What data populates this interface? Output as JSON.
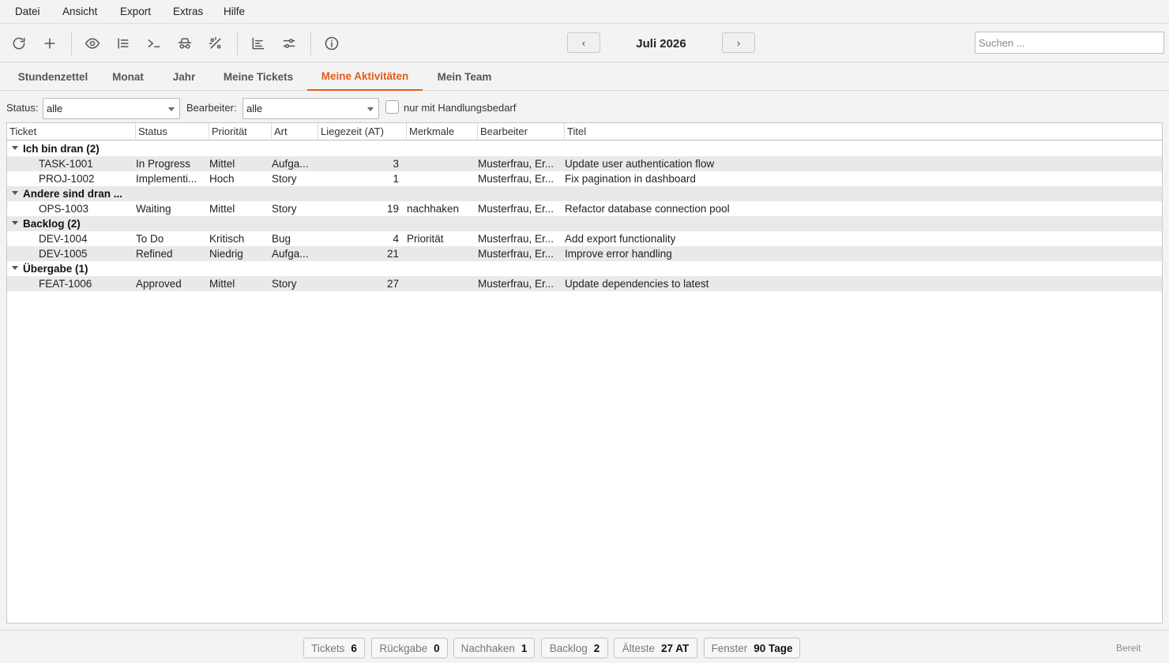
{
  "menu": [
    "Datei",
    "Ansicht",
    "Export",
    "Extras",
    "Hilfe"
  ],
  "toolbar": {
    "icons": [
      "refresh-icon",
      "plus-icon",
      "eye-icon",
      "list-icon",
      "terminal-icon",
      "incognito-icon",
      "percent-icon",
      "align-left-icon",
      "sliders-icon",
      "info-icon"
    ],
    "prev_label": "‹",
    "next_label": "›",
    "month": "Juli 2026",
    "search_placeholder": "Suchen ..."
  },
  "tabs": [
    {
      "label": "Stundenzettel",
      "active": false
    },
    {
      "label": "Monat",
      "active": false
    },
    {
      "label": "Jahr",
      "active": false
    },
    {
      "label": "Meine Tickets",
      "active": false
    },
    {
      "label": "Meine Aktivitäten",
      "active": true
    },
    {
      "label": "Mein Team",
      "active": false
    }
  ],
  "accent_color": "#e35d1a",
  "filters": {
    "status_label": "Status:",
    "status_value": "alle",
    "bearbeiter_label": "Bearbeiter:",
    "bearbeiter_value": "alle",
    "checkbox_label": "nur mit Handlungsbedarf",
    "checkbox_checked": false
  },
  "table": {
    "columns": [
      "Ticket",
      "Status",
      "Priorität",
      "Art",
      "Liegezeit (AT)",
      "Merkmale",
      "Bearbeiter",
      "Titel"
    ],
    "groups": [
      {
        "label": "Ich bin dran  (2)",
        "rows": [
          {
            "ticket": "TASK-1001",
            "status": "In Progress",
            "prio": "Mittel",
            "art": "Aufga...",
            "liegezeit": "3",
            "merkmale": "",
            "bearbeiter": "Musterfrau, Er...",
            "titel": "Update user authentication flow"
          },
          {
            "ticket": "PROJ-1002",
            "status": "Implementi...",
            "prio": "Hoch",
            "art": "Story",
            "liegezeit": "1",
            "merkmale": "",
            "bearbeiter": "Musterfrau, Er...",
            "titel": "Fix pagination in dashboard"
          }
        ]
      },
      {
        "label": "Andere sind dran ...",
        "rows": [
          {
            "ticket": "OPS-1003",
            "status": "Waiting",
            "prio": "Mittel",
            "art": "Story",
            "liegezeit": "19",
            "merkmale": "nachhaken",
            "bearbeiter": "Musterfrau, Er...",
            "titel": "Refactor database connection pool"
          }
        ]
      },
      {
        "label": "Backlog  (2)",
        "rows": [
          {
            "ticket": "DEV-1004",
            "status": "To Do",
            "prio": "Kritisch",
            "art": "Bug",
            "liegezeit": "4",
            "merkmale": "Priorität",
            "bearbeiter": "Musterfrau, Er...",
            "titel": "Add export functionality"
          },
          {
            "ticket": "DEV-1005",
            "status": "Refined",
            "prio": "Niedrig",
            "art": "Aufga...",
            "liegezeit": "21",
            "merkmale": "",
            "bearbeiter": "Musterfrau, Er...",
            "titel": "Improve error handling"
          }
        ]
      },
      {
        "label": "Übergabe  (1)",
        "rows": [
          {
            "ticket": "FEAT-1006",
            "status": "Approved",
            "prio": "Mittel",
            "art": "Story",
            "liegezeit": "27",
            "merkmale": "",
            "bearbeiter": "Musterfrau, Er...",
            "titel": "Update dependencies to latest"
          }
        ]
      }
    ]
  },
  "status_chips": [
    {
      "label": "Tickets",
      "value": "6"
    },
    {
      "label": "Rückgabe",
      "value": "0"
    },
    {
      "label": "Nachhaken",
      "value": "1"
    },
    {
      "label": "Backlog",
      "value": "2"
    },
    {
      "label": "Älteste",
      "value": "27 AT"
    },
    {
      "label": "Fenster",
      "value": "90 Tage"
    }
  ],
  "status_text": "Bereit"
}
